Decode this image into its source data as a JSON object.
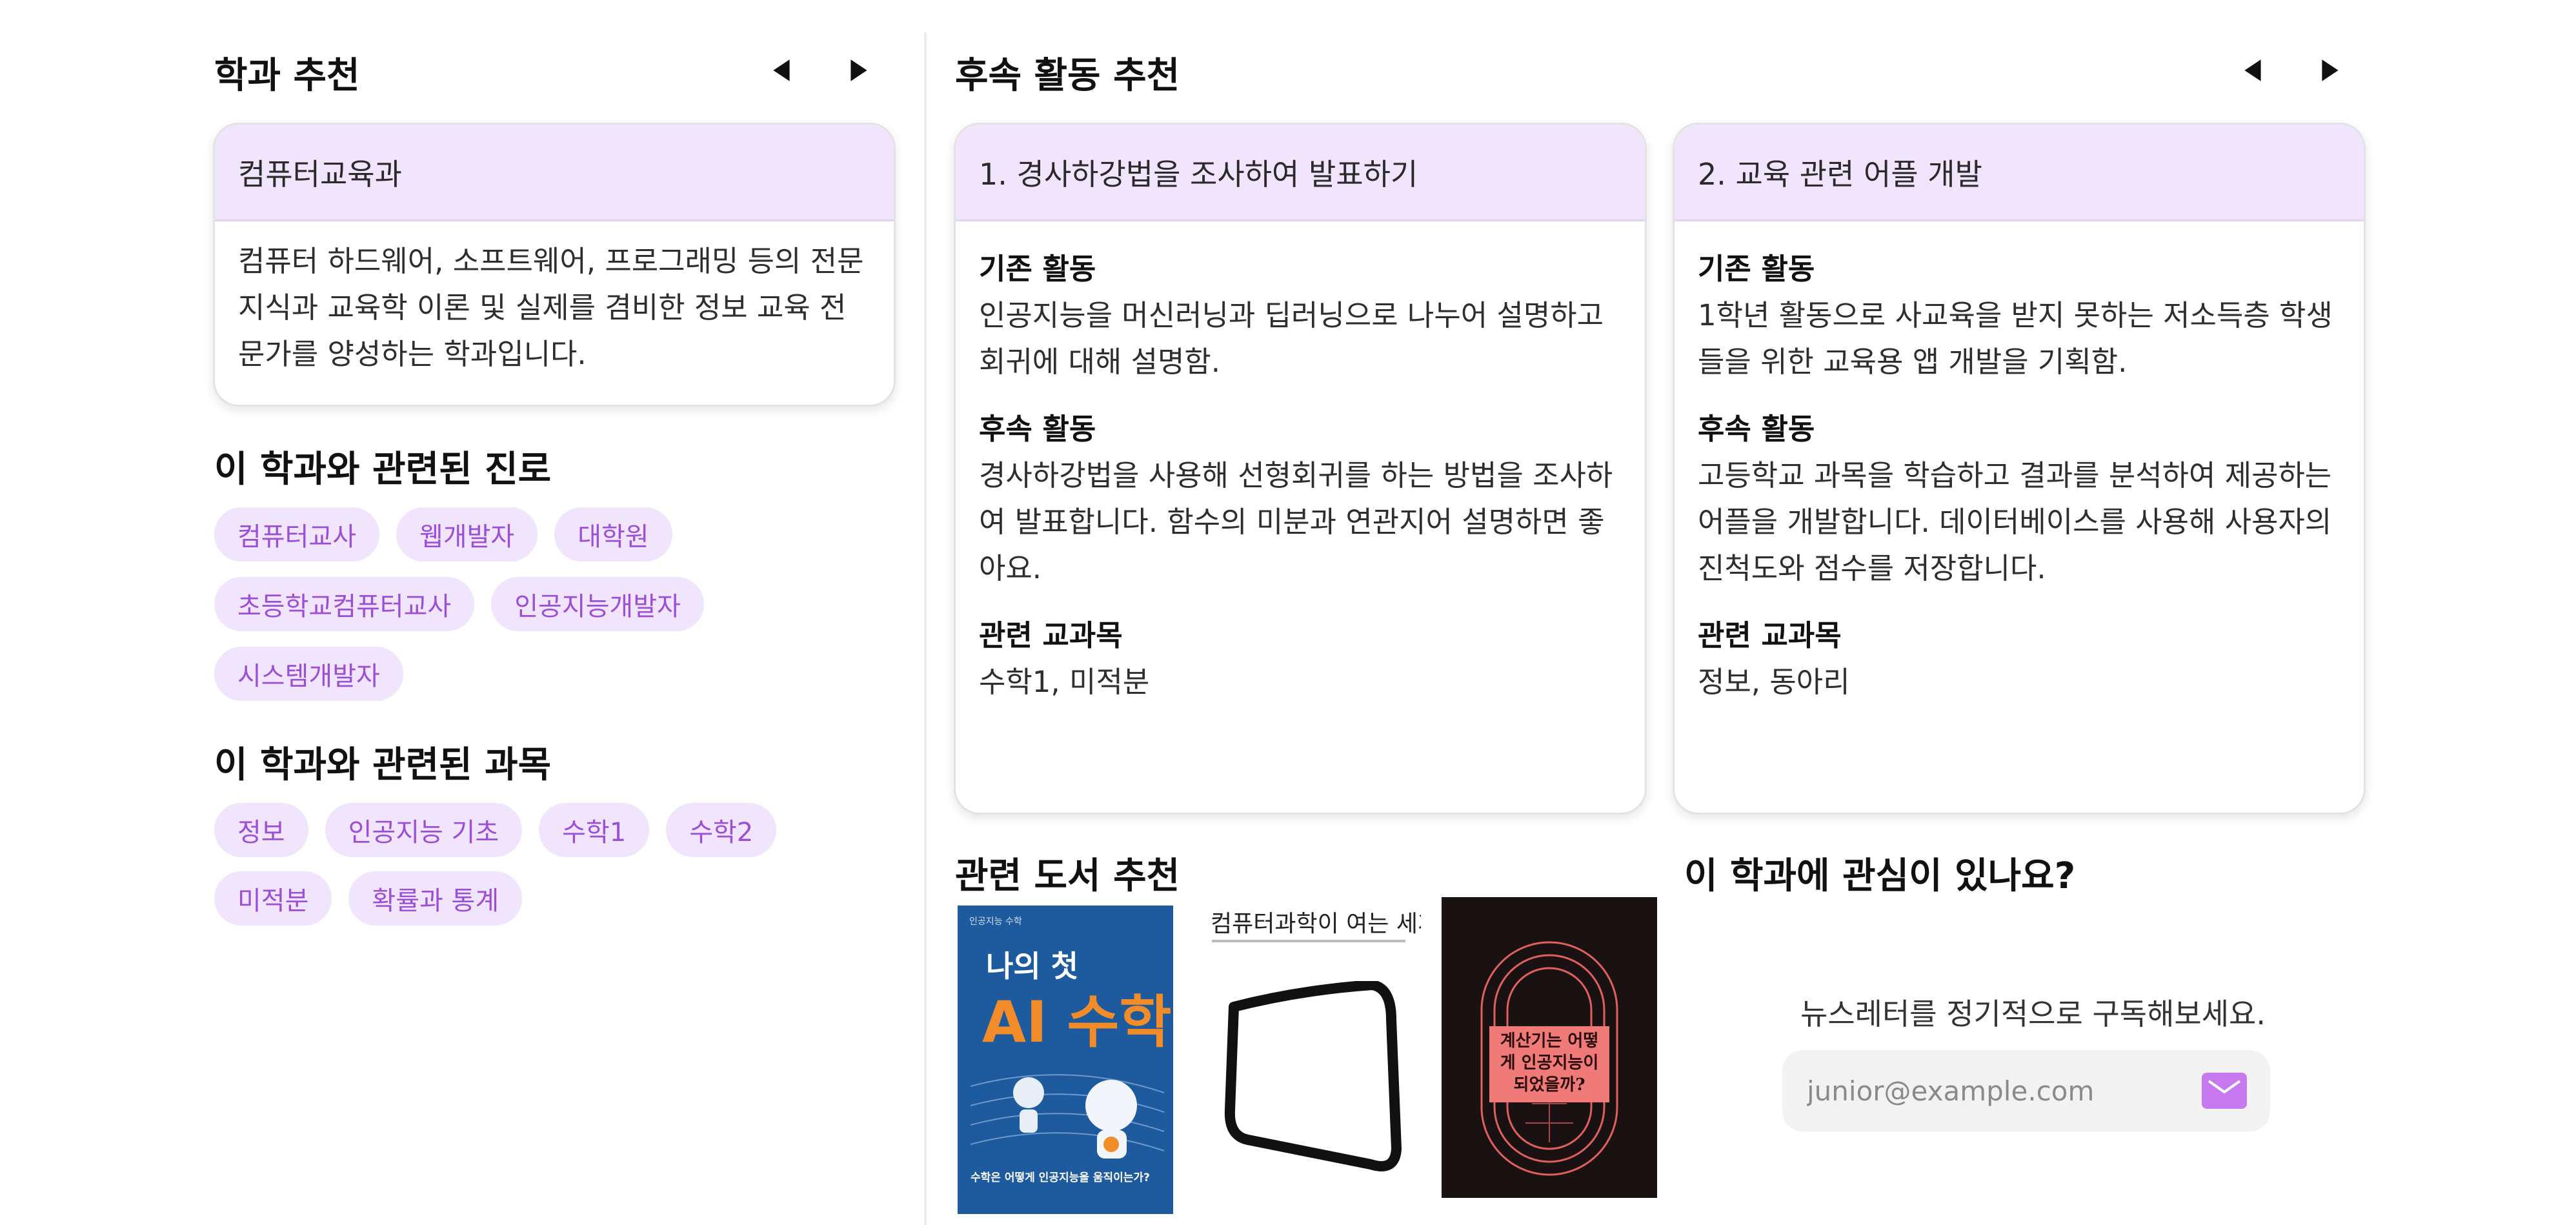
{
  "left": {
    "title": "학과 추천",
    "department": {
      "name": "컴퓨터교육과",
      "description": "컴퓨터 하드웨어, 소프트웨어, 프로그래밍 등의 전문 지식과 교육학 이론 및 실제를 겸비한 정보 교육 전문가를 양성하는 학과입니다."
    },
    "careers": {
      "title": "이 학과와 관련된 진로",
      "chips": [
        "컴퓨터교사",
        "웹개발자",
        "대학원",
        "초등학교컴퓨터교사",
        "인공지능개발자",
        "시스템개발자"
      ]
    },
    "subjects": {
      "title": "이 학과와 관련된 과목",
      "chips": [
        "정보",
        "인공지능 기초",
        "수학1",
        "수학2",
        "미적분",
        "확률과 통계"
      ]
    }
  },
  "activities": {
    "title": "후속 활동 추천",
    "labels": {
      "base": "기존 활동",
      "follow": "후속 활동",
      "subjects": "관련 교과목"
    },
    "cards": [
      {
        "title": "1. 경사하강법을 조사하여 발표하기",
        "base": "인공지능을 머신러닝과 딥러닝으로 나누어 설명하고 회귀에 대해 설명함.",
        "follow": "경사하강법을 사용해 선형회귀를 하는 방법을 조사하여 발표합니다. 함수의 미분과 연관지어 설명하면 좋아요.",
        "subjects": "수학1, 미적분"
      },
      {
        "title": "2. 교육 관련 어플 개발",
        "base": "1학년 활동으로 사교육을 받지 못하는 저소득층 학생들을 위한 교육용 앱 개발을 기획함.",
        "follow": "고등학교 과목을 학습하고 결과를 분석하여 제공하는 어플을 개발합니다. 데이터베이스를 사용해 사용자의 진척도와 점수를 저장합니다.",
        "subjects": "정보, 동아리"
      }
    ]
  },
  "books": {
    "title": "관련 도서 추천",
    "items": [
      {
        "cover_title": "나의 첫",
        "cover_title2": "AI 수학",
        "cover_sub": "수학은 어떻게 인공지능을 움직이는가?",
        "bg": "#1d5a9e",
        "accent": "#f28c28"
      },
      {
        "cover_title": "컴퓨터과학이 여는 세계",
        "bg": "#ffffff"
      },
      {
        "cover_title": "계산기는 어떻게 인공지능이 되었을까?",
        "bg": "#1a1112",
        "accent": "#e0605e"
      }
    ]
  },
  "newsletter": {
    "title": "이 학과에 관심이 있나요?",
    "text": "뉴스레터를 정기적으로 구독해보세요.",
    "placeholder": "junior@example.com",
    "accent": "#c77af0"
  },
  "colors": {
    "chip_bg": "#f1e4fd",
    "chip_text": "#9b4fd6",
    "card_head": "#f1e4fd"
  }
}
